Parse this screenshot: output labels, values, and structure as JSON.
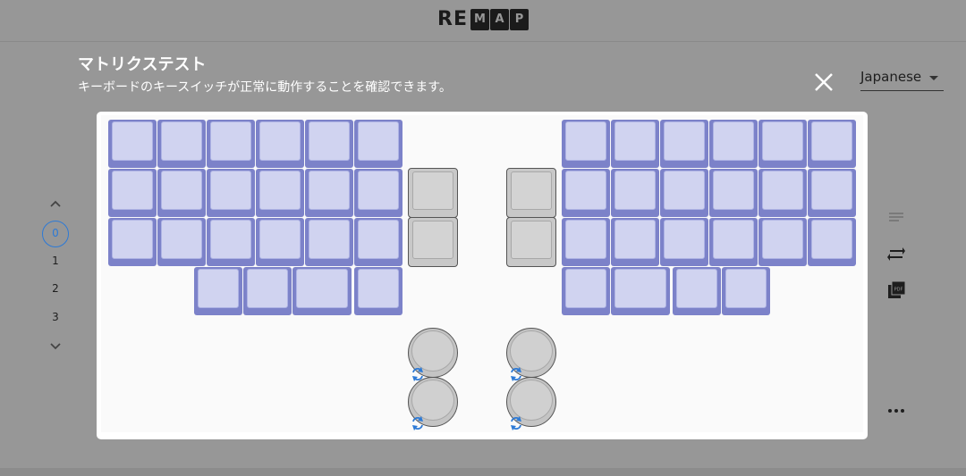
{
  "header": {
    "logo_text": "RE",
    "logo_boxes": [
      "M",
      "A",
      "P"
    ]
  },
  "page": {
    "title": "マトリクステスト",
    "subtitle": "キーボードのキースイッチが正常に動作することを確認できます。"
  },
  "language": {
    "selected": "Japanese"
  },
  "layers": {
    "items": [
      "0",
      "1",
      "2",
      "3"
    ],
    "active": "0"
  },
  "icons": {
    "close": "close-icon",
    "layer_up": "chevron-up-icon",
    "layer_down": "chevron-down-icon",
    "encoder": "rotate-icon",
    "side": [
      "list-icon",
      "swap-icon",
      "pdf-icon",
      "more-icon"
    ]
  },
  "colors": {
    "background": "#979797",
    "key_active": "#7c82c9",
    "key_cap": "#d0d3f0",
    "key_inactive": "#c8c8c8",
    "accent": "#2d7ad6"
  }
}
